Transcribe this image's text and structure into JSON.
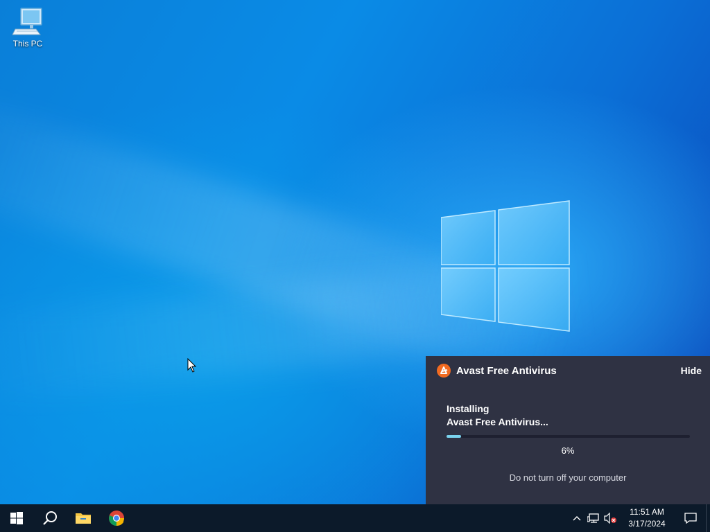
{
  "desktop": {
    "icons": [
      {
        "label": "This PC",
        "icon": "computer-icon"
      }
    ]
  },
  "avast_panel": {
    "title": "Avast Free Antivirus",
    "hide_label": "Hide",
    "status_line1": "Installing",
    "status_line2": "Avast Free Antivirus...",
    "progress_percent": 6,
    "progress_text": "6%",
    "note": "Do not turn off your computer",
    "colors": {
      "background": "#2f3243",
      "progress": "#7ad3ee",
      "brand": "#f26b21"
    }
  },
  "taskbar": {
    "pinned": [
      {
        "name": "start-button",
        "icon": "windows-icon"
      },
      {
        "name": "search-button",
        "icon": "search-icon"
      },
      {
        "name": "file-explorer-button",
        "icon": "folder-icon"
      },
      {
        "name": "chrome-button",
        "icon": "chrome-icon"
      }
    ],
    "tray": {
      "icons": [
        "chevron-up-icon",
        "network-icon",
        "volume-muted-icon"
      ],
      "time": "11:51 AM",
      "date": "3/17/2024"
    }
  }
}
